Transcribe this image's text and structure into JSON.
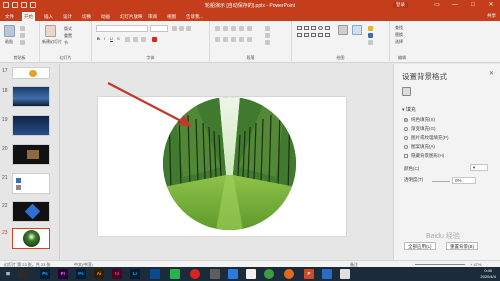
{
  "window": {
    "title": "轮船演示 [自动保存的].pptx - PowerPoint",
    "login_label": "登录",
    "controls": [
      "—",
      "□",
      "✕"
    ]
  },
  "tabs": [
    "文件",
    "开始",
    "插入",
    "设计",
    "切换",
    "动画",
    "幻灯片放映",
    "审阅",
    "视图",
    "告诉我..."
  ],
  "share_label": "共享",
  "ribbon": {
    "groups": [
      "剪贴板",
      "幻灯片",
      "字体",
      "段落",
      "绘图",
      "编辑"
    ],
    "paste_label": "粘贴",
    "new_slide_label": "新建幻灯片",
    "layout_label": "版式",
    "reset_label": "重置",
    "section_label": "节",
    "find_label": "查找",
    "replace_label": "替换",
    "select_label": "选择"
  },
  "thumbnails": {
    "numbers": [
      "17",
      "18",
      "19",
      "20",
      "21",
      "22",
      "23"
    ],
    "active": "23"
  },
  "pane": {
    "title": "设置背景格式",
    "close": "✕",
    "section": "填充",
    "options": [
      {
        "label": "纯色填充(S)",
        "type": "radio",
        "checked": true
      },
      {
        "label": "渐变填充(G)",
        "type": "radio",
        "checked": false
      },
      {
        "label": "图片或纹理填充(P)",
        "type": "radio",
        "checked": false
      },
      {
        "label": "图案填充(A)",
        "type": "radio",
        "checked": false
      },
      {
        "label": "隐藏背景图形(H)",
        "type": "check",
        "checked": false
      }
    ],
    "color_label": "颜色(C)",
    "transparency_label": "透明度(T)",
    "transparency_value": "0%",
    "apply_all_label": "全部应用(L)",
    "reset_label": "重置背景(B)"
  },
  "status": {
    "slide_info": "幻灯片 第 23 张，共 23 张",
    "language": "中文(中国)",
    "notes": "备注",
    "zoom": "+ 47%"
  },
  "taskbar": {
    "icons": [
      "Ps",
      "Pr",
      "Ps",
      "Ai",
      "Id",
      "Lr",
      "",
      "",
      "",
      "",
      "",
      "",
      "",
      "",
      "",
      "P",
      "",
      ""
    ],
    "time": "0:40",
    "date": "2020/4/4"
  },
  "watermark": "Baidu 经验",
  "colors": {
    "accent": "#c43e1c",
    "ribbon_bg": "#f3f3f3",
    "arrow": "#c0392b"
  }
}
